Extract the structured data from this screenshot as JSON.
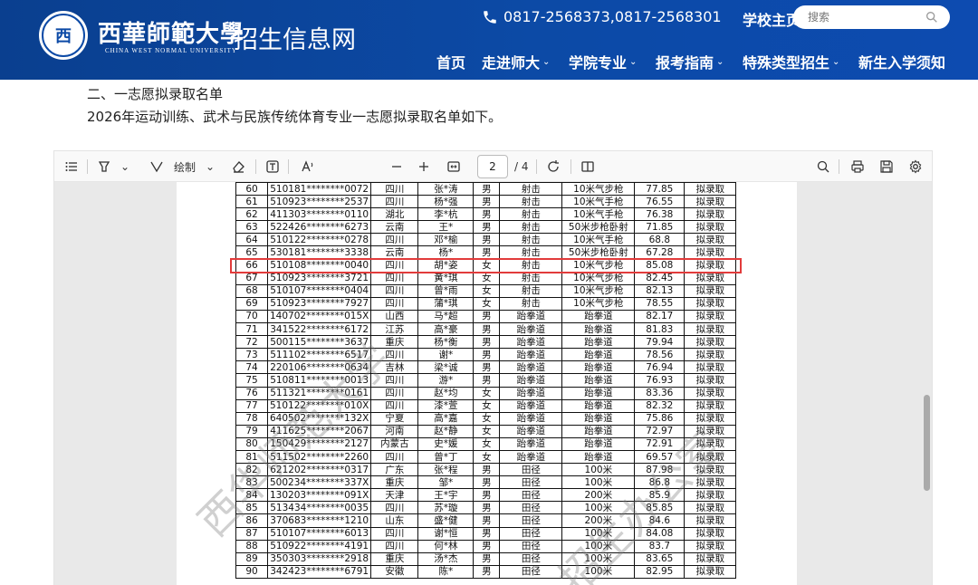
{
  "header": {
    "logo_glyph": "西",
    "university_name": "西華師範大學",
    "university_en": "CHINA WEST NORMAL UNIVERSITY",
    "site_name": "招生信息网",
    "phone": "0817-2568373,0817-2568301",
    "home_link": "学校主页",
    "search_placeholder": "搜索",
    "nav": [
      {
        "label": "首页",
        "dropdown": false
      },
      {
        "label": "走进师大",
        "dropdown": true
      },
      {
        "label": "学院专业",
        "dropdown": true
      },
      {
        "label": "报考指南",
        "dropdown": true
      },
      {
        "label": "特殊类型招生",
        "dropdown": true
      },
      {
        "label": "新生入学须知",
        "dropdown": false
      }
    ]
  },
  "content": {
    "section_title": "二、一志愿拟录取名单",
    "section_desc": "2026年运动训练、武术与民族传统体育专业一志愿拟录取名单如下。"
  },
  "viewer": {
    "draw_label": "绘制",
    "current_page": "2",
    "total_pages": "/ 4",
    "watermark_1": "西华师范大学",
    "watermark_2": "招生办公室"
  },
  "roster": {
    "highlighted_row": "66",
    "rows": [
      [
        "60",
        "510181********0072",
        "四川",
        "张*涛",
        "男",
        "射击",
        "10米气步枪",
        "77.85",
        "拟录取"
      ],
      [
        "61",
        "510923********2537",
        "四川",
        "杨*强",
        "男",
        "射击",
        "10米气手枪",
        "76.55",
        "拟录取"
      ],
      [
        "62",
        "411303********0110",
        "湖北",
        "李*杭",
        "男",
        "射击",
        "10米气手枪",
        "76.38",
        "拟录取"
      ],
      [
        "63",
        "522426********6273",
        "云南",
        "王*",
        "男",
        "射击",
        "50米步枪卧射",
        "71.85",
        "拟录取"
      ],
      [
        "64",
        "510122********0278",
        "四川",
        "邓*榆",
        "男",
        "射击",
        "10米气手枪",
        "68.8",
        "拟录取"
      ],
      [
        "65",
        "530181********3338",
        "云南",
        "杨*",
        "男",
        "射击",
        "50米步枪卧射",
        "67.28",
        "拟录取"
      ],
      [
        "66",
        "510108********0040",
        "四川",
        "胡*姿",
        "女",
        "射击",
        "10米气步枪",
        "85.08",
        "拟录取"
      ],
      [
        "67",
        "510923********3721",
        "四川",
        "黄*琪",
        "女",
        "射击",
        "10米气步枪",
        "82.45",
        "拟录取"
      ],
      [
        "68",
        "510107********0404",
        "四川",
        "曾*雨",
        "女",
        "射击",
        "10米气步枪",
        "82.13",
        "拟录取"
      ],
      [
        "69",
        "510923********7927",
        "四川",
        "蒲*琪",
        "女",
        "射击",
        "10米气步枪",
        "78.55",
        "拟录取"
      ],
      [
        "70",
        "140702********015X",
        "山西",
        "马*超",
        "男",
        "跆拳道",
        "跆拳道",
        "82.17",
        "拟录取"
      ],
      [
        "71",
        "341522********6172",
        "江苏",
        "高*豪",
        "男",
        "跆拳道",
        "跆拳道",
        "81.83",
        "拟录取"
      ],
      [
        "72",
        "500115********3637",
        "重庆",
        "杨*衡",
        "男",
        "跆拳道",
        "跆拳道",
        "79.94",
        "拟录取"
      ],
      [
        "73",
        "511102********6517",
        "四川",
        "谢*",
        "男",
        "跆拳道",
        "跆拳道",
        "78.56",
        "拟录取"
      ],
      [
        "74",
        "220106********0634",
        "吉林",
        "梁*诚",
        "男",
        "跆拳道",
        "跆拳道",
        "76.94",
        "拟录取"
      ],
      [
        "75",
        "510811********0013",
        "四川",
        "游*",
        "男",
        "跆拳道",
        "跆拳道",
        "76.93",
        "拟录取"
      ],
      [
        "76",
        "511321********0161",
        "四川",
        "赵*均",
        "女",
        "跆拳道",
        "跆拳道",
        "83.36",
        "拟录取"
      ],
      [
        "77",
        "510122********010X",
        "四川",
        "漆*萱",
        "女",
        "跆拳道",
        "跆拳道",
        "82.32",
        "拟录取"
      ],
      [
        "78",
        "640502********132X",
        "宁夏",
        "高*嘉",
        "女",
        "跆拳道",
        "跆拳道",
        "75.86",
        "拟录取"
      ],
      [
        "79",
        "411625********2067",
        "河南",
        "赵*静",
        "女",
        "跆拳道",
        "跆拳道",
        "72.97",
        "拟录取"
      ],
      [
        "80",
        "150429********2127",
        "内蒙古",
        "史*媛",
        "女",
        "跆拳道",
        "跆拳道",
        "72.91",
        "拟录取"
      ],
      [
        "81",
        "511502********2260",
        "四川",
        "曾*丁",
        "女",
        "跆拳道",
        "跆拳道",
        "69.57",
        "拟录取"
      ],
      [
        "82",
        "621202********0317",
        "广东",
        "张*程",
        "男",
        "田径",
        "100米",
        "87.98",
        "拟录取"
      ],
      [
        "83",
        "500234********337X",
        "重庆",
        "邹*",
        "男",
        "田径",
        "100米",
        "86.8",
        "拟录取"
      ],
      [
        "84",
        "130203********091X",
        "天津",
        "王*宇",
        "男",
        "田径",
        "200米",
        "85.9",
        "拟录取"
      ],
      [
        "85",
        "513434********0035",
        "四川",
        "苏*璇",
        "男",
        "田径",
        "100米",
        "85.85",
        "拟录取"
      ],
      [
        "86",
        "370683********1210",
        "山东",
        "盛*健",
        "男",
        "田径",
        "200米",
        "84.6",
        "拟录取"
      ],
      [
        "87",
        "510107********6013",
        "四川",
        "谢*恒",
        "男",
        "田径",
        "100米",
        "84.08",
        "拟录取"
      ],
      [
        "88",
        "510922********4191",
        "四川",
        "何*林",
        "男",
        "田径",
        "100米",
        "83.7",
        "拟录取"
      ],
      [
        "89",
        "350303********2918",
        "重庆",
        "汤*杰",
        "男",
        "田径",
        "100米",
        "83.65",
        "拟录取"
      ],
      [
        "90",
        "342423********6791",
        "安徽",
        "陈*",
        "男",
        "田径",
        "100米",
        "82.95",
        "拟录取"
      ]
    ]
  }
}
